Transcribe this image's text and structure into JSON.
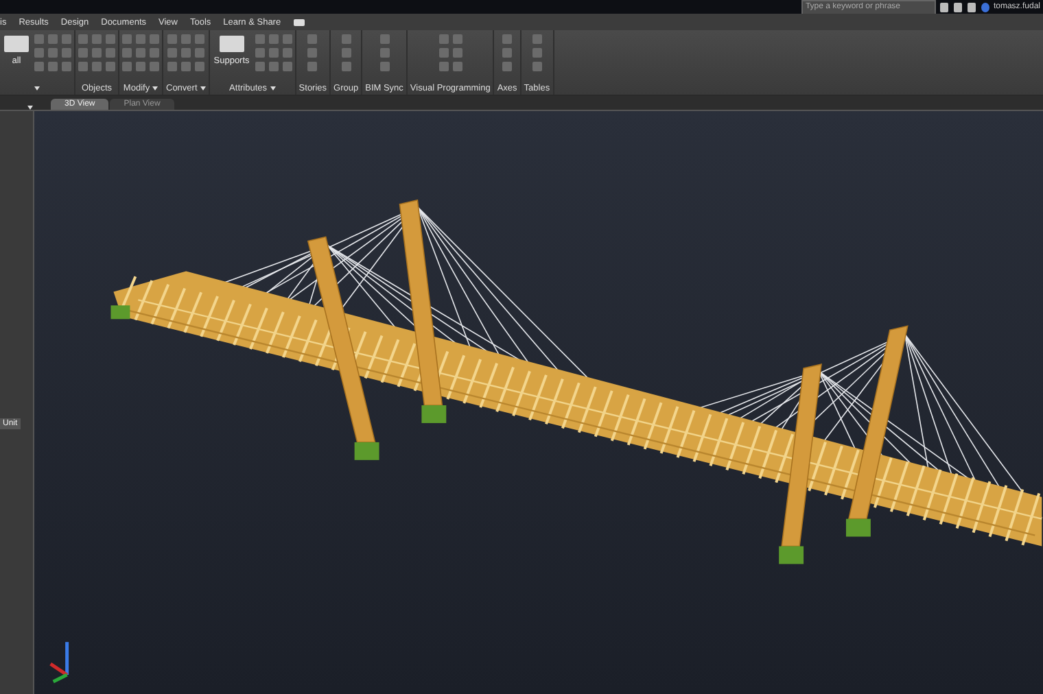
{
  "window": {
    "search": {
      "placeholder": "Type a keyword or phrase"
    },
    "user": "tomasz.fudal"
  },
  "menu_tabs": [
    {
      "label": "is"
    },
    {
      "label": "Results"
    },
    {
      "label": "Design"
    },
    {
      "label": "Documents"
    },
    {
      "label": "View"
    },
    {
      "label": "Tools"
    },
    {
      "label": "Learn & Share"
    }
  ],
  "ribbon_groups": [
    {
      "button_label": "all",
      "has_menu": true
    },
    {
      "label": "Objects",
      "has_menu": false
    },
    {
      "label": "Modify",
      "has_menu": true
    },
    {
      "label": "Convert",
      "has_menu": true
    },
    {
      "button_label": "Supports",
      "label": "Attributes",
      "has_menu": true
    },
    {
      "label": "Stories",
      "has_menu": false
    },
    {
      "label": "Group",
      "has_menu": false
    },
    {
      "label": "BIM Sync",
      "has_menu": false
    },
    {
      "label": "Visual Programming",
      "has_menu": false
    },
    {
      "label": "Axes",
      "has_menu": false
    },
    {
      "label": "Tables",
      "has_menu": false
    }
  ],
  "view_tabs": [
    {
      "label": "3D View",
      "selected": true
    },
    {
      "label": "Plan View",
      "selected": false
    }
  ],
  "side_panel": {
    "header": "Unit"
  }
}
